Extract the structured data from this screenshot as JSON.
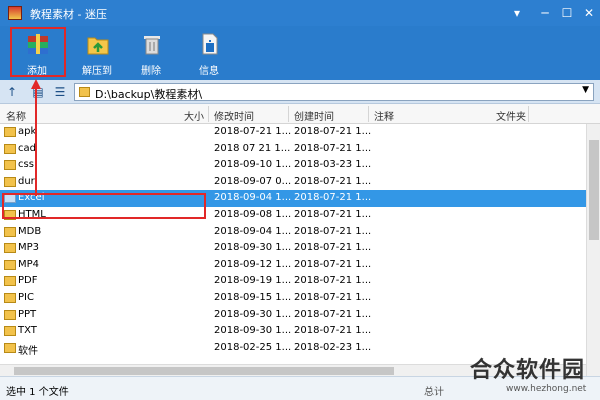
{
  "window": {
    "title": "教程素材 - 迷压"
  },
  "toolbar": {
    "add_label": "添加",
    "extract_label": "解压到",
    "delete_label": "删除",
    "info_label": "信息"
  },
  "address": {
    "path": "D:\\backup\\教程素材\\"
  },
  "columns": {
    "name": "名称",
    "size": "大小",
    "modified": "修改时间",
    "created": "创建时间",
    "comment": "注释",
    "folder": "文件夹"
  },
  "files": [
    {
      "name": "apk",
      "modified": "2018-07-21 1...",
      "created": "2018-07-21 1..."
    },
    {
      "name": "cad",
      "modified": "2018 07 21 1...",
      "created": "2018-07-21 1..."
    },
    {
      "name": "css",
      "modified": "2018-09-10 1...",
      "created": "2018-03-23 1..."
    },
    {
      "name": "dur",
      "modified": "2018-09-07 0...",
      "created": "2018-07-21 1..."
    },
    {
      "name": "Excel",
      "modified": "2018-09-04 1...",
      "created": "2018-07-21 1...",
      "selected": true
    },
    {
      "name": "HTML",
      "modified": "2018-09-08 1...",
      "created": "2018-07-21 1..."
    },
    {
      "name": "MDB",
      "modified": "2018-09-04 1...",
      "created": "2018-07-21 1..."
    },
    {
      "name": "MP3",
      "modified": "2018-09-30 1...",
      "created": "2018-07-21 1..."
    },
    {
      "name": "MP4",
      "modified": "2018-09-12 1...",
      "created": "2018-07-21 1..."
    },
    {
      "name": "PDF",
      "modified": "2018-09-19 1...",
      "created": "2018-07-21 1..."
    },
    {
      "name": "PIC",
      "modified": "2018-09-15 1...",
      "created": "2018-07-21 1..."
    },
    {
      "name": "PPT",
      "modified": "2018-09-30 1...",
      "created": "2018-07-21 1..."
    },
    {
      "name": "TXT",
      "modified": "2018-09-30 1...",
      "created": "2018-07-21 1..."
    },
    {
      "name": "软件",
      "modified": "2018-02-25 1...",
      "created": "2018-02-23 1..."
    }
  ],
  "status": {
    "selection": "选中 1 个文件",
    "total": "总计"
  },
  "watermark": {
    "logo": "合众软件园",
    "url": "www.hezhong.net"
  },
  "colors": {
    "titlebar": "#2d7fd0",
    "selection": "#3397e6",
    "annotation": "#e12828"
  }
}
